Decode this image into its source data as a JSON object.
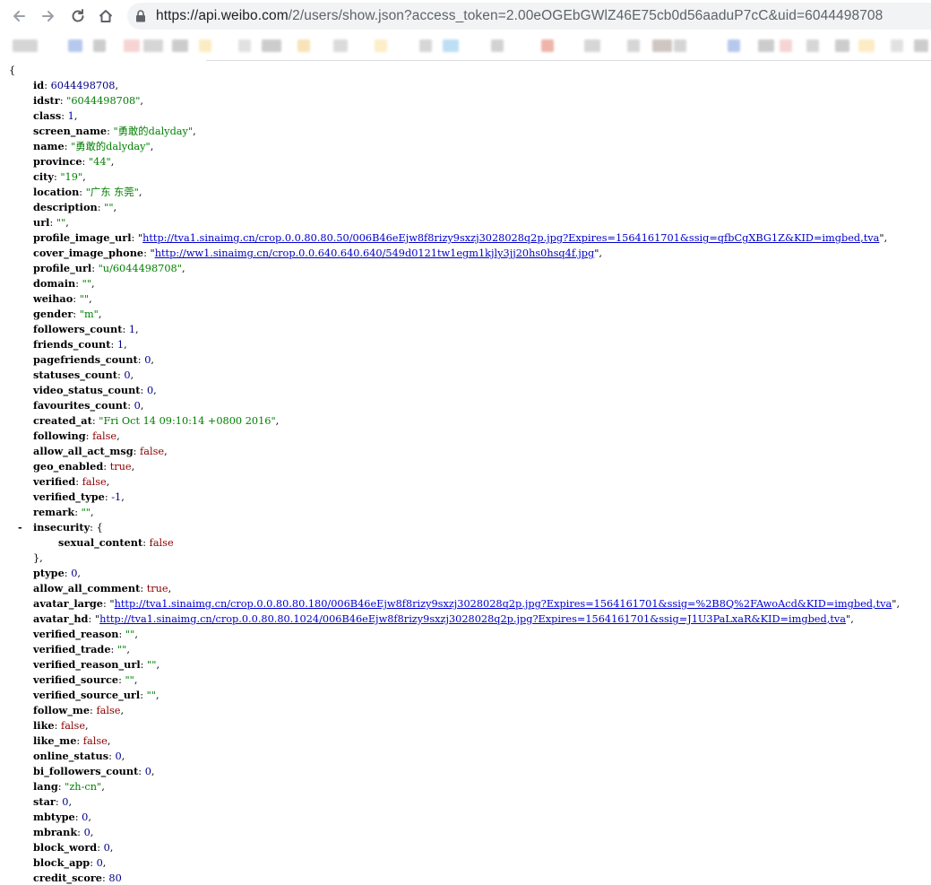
{
  "browser": {
    "url_host": "https://api.weibo.com",
    "url_rest": "/2/users/show.json?access_token=2.00eOGEbGWlZ46E75cb0d56aaduP7cC&uid=6044498708"
  },
  "bookmarks_colors": [
    "#c8c8c8",
    "#9fb6e8",
    "#bcbcbc",
    "#f3c6c6",
    "#c9c9c9",
    "#bcbcbc",
    "#fbe6b0",
    "#d8d8d8",
    "#bcbcbc",
    "#f6d9a0",
    "#d0d0d0",
    "#fbe9b3",
    "#c9c9c9",
    "#a8d4f0",
    "#c4c4c4",
    "#e89b8e",
    "#c9c9c9",
    "#c9c9c9",
    "#bfb3ad"
  ],
  "json": {
    "open_brace": "{",
    "close_brace": "}",
    "collapser_symbol": "-",
    "fields": [
      {
        "key": "id",
        "type": "number",
        "value": "6044498708"
      },
      {
        "key": "idstr",
        "type": "string",
        "value": "\"6044498708\""
      },
      {
        "key": "class",
        "type": "number",
        "value": "1"
      },
      {
        "key": "screen_name",
        "type": "string",
        "value": "\"勇敢的dalyday\""
      },
      {
        "key": "name",
        "type": "string",
        "value": "\"勇敢的dalyday\""
      },
      {
        "key": "province",
        "type": "string",
        "value": "\"44\""
      },
      {
        "key": "city",
        "type": "string",
        "value": "\"19\""
      },
      {
        "key": "location",
        "type": "string",
        "value": "\"广东 东莞\""
      },
      {
        "key": "description",
        "type": "string",
        "value": "\"\""
      },
      {
        "key": "url",
        "type": "string",
        "value": "\"\""
      },
      {
        "key": "profile_image_url",
        "type": "url",
        "value": "http://tva1.sinaimg.cn/crop.0.0.80.80.50/006B46eEjw8f8rizy9sxzj3028028q2p.jpg?Expires=1564161701&ssig=qfbCgXBG1Z&KID=imgbed,tva"
      },
      {
        "key": "cover_image_phone",
        "type": "url",
        "value": "http://ww1.sinaimg.cn/crop.0.0.640.640.640/549d0121tw1egm1kjly3jj20hs0hsq4f.jpg"
      },
      {
        "key": "profile_url",
        "type": "string",
        "value": "\"u/6044498708\""
      },
      {
        "key": "domain",
        "type": "string",
        "value": "\"\""
      },
      {
        "key": "weihao",
        "type": "string",
        "value": "\"\""
      },
      {
        "key": "gender",
        "type": "string",
        "value": "\"m\""
      },
      {
        "key": "followers_count",
        "type": "number",
        "value": "1"
      },
      {
        "key": "friends_count",
        "type": "number",
        "value": "1"
      },
      {
        "key": "pagefriends_count",
        "type": "number",
        "value": "0"
      },
      {
        "key": "statuses_count",
        "type": "number",
        "value": "0"
      },
      {
        "key": "video_status_count",
        "type": "number",
        "value": "0"
      },
      {
        "key": "favourites_count",
        "type": "number",
        "value": "0"
      },
      {
        "key": "created_at",
        "type": "string",
        "value": "\"Fri Oct 14 09:10:14 +0800 2016\""
      },
      {
        "key": "following",
        "type": "bool",
        "value": "false"
      },
      {
        "key": "allow_all_act_msg",
        "type": "bool",
        "value": "false"
      },
      {
        "key": "geo_enabled",
        "type": "bool",
        "value": "true"
      },
      {
        "key": "verified",
        "type": "bool",
        "value": "false"
      },
      {
        "key": "verified_type",
        "type": "number",
        "value": "-1"
      },
      {
        "key": "remark",
        "type": "string",
        "value": "\"\""
      },
      {
        "key": "insecurity",
        "type": "object",
        "children": [
          {
            "key": "sexual_content",
            "type": "bool",
            "value": "false"
          }
        ]
      },
      {
        "key": "ptype",
        "type": "number",
        "value": "0"
      },
      {
        "key": "allow_all_comment",
        "type": "bool",
        "value": "true"
      },
      {
        "key": "avatar_large",
        "type": "url",
        "value": "http://tva1.sinaimg.cn/crop.0.0.80.80.180/006B46eEjw8f8rizy9sxzj3028028q2p.jpg?Expires=1564161701&ssig=%2B8Q%2FAwoAcd&KID=imgbed,tva"
      },
      {
        "key": "avatar_hd",
        "type": "url",
        "value": "http://tva1.sinaimg.cn/crop.0.0.80.80.1024/006B46eEjw8f8rizy9sxzj3028028q2p.jpg?Expires=1564161701&ssig=J1U3PaLxaR&KID=imgbed,tva"
      },
      {
        "key": "verified_reason",
        "type": "string",
        "value": "\"\""
      },
      {
        "key": "verified_trade",
        "type": "string",
        "value": "\"\""
      },
      {
        "key": "verified_reason_url",
        "type": "string",
        "value": "\"\""
      },
      {
        "key": "verified_source",
        "type": "string",
        "value": "\"\""
      },
      {
        "key": "verified_source_url",
        "type": "string",
        "value": "\"\""
      },
      {
        "key": "follow_me",
        "type": "bool",
        "value": "false"
      },
      {
        "key": "like",
        "type": "bool",
        "value": "false"
      },
      {
        "key": "like_me",
        "type": "bool",
        "value": "false"
      },
      {
        "key": "online_status",
        "type": "number",
        "value": "0"
      },
      {
        "key": "bi_followers_count",
        "type": "number",
        "value": "0"
      },
      {
        "key": "lang",
        "type": "string",
        "value": "\"zh-cn\""
      },
      {
        "key": "star",
        "type": "number",
        "value": "0"
      },
      {
        "key": "mbtype",
        "type": "number",
        "value": "0"
      },
      {
        "key": "mbrank",
        "type": "number",
        "value": "0"
      },
      {
        "key": "block_word",
        "type": "number",
        "value": "0"
      },
      {
        "key": "block_app",
        "type": "number",
        "value": "0"
      },
      {
        "key": "credit_score",
        "type": "number",
        "value": "80"
      }
    ]
  },
  "colors": {
    "string": "#008000",
    "number": "#00008b",
    "bool": "#8b0000",
    "url": "#0000cc"
  }
}
